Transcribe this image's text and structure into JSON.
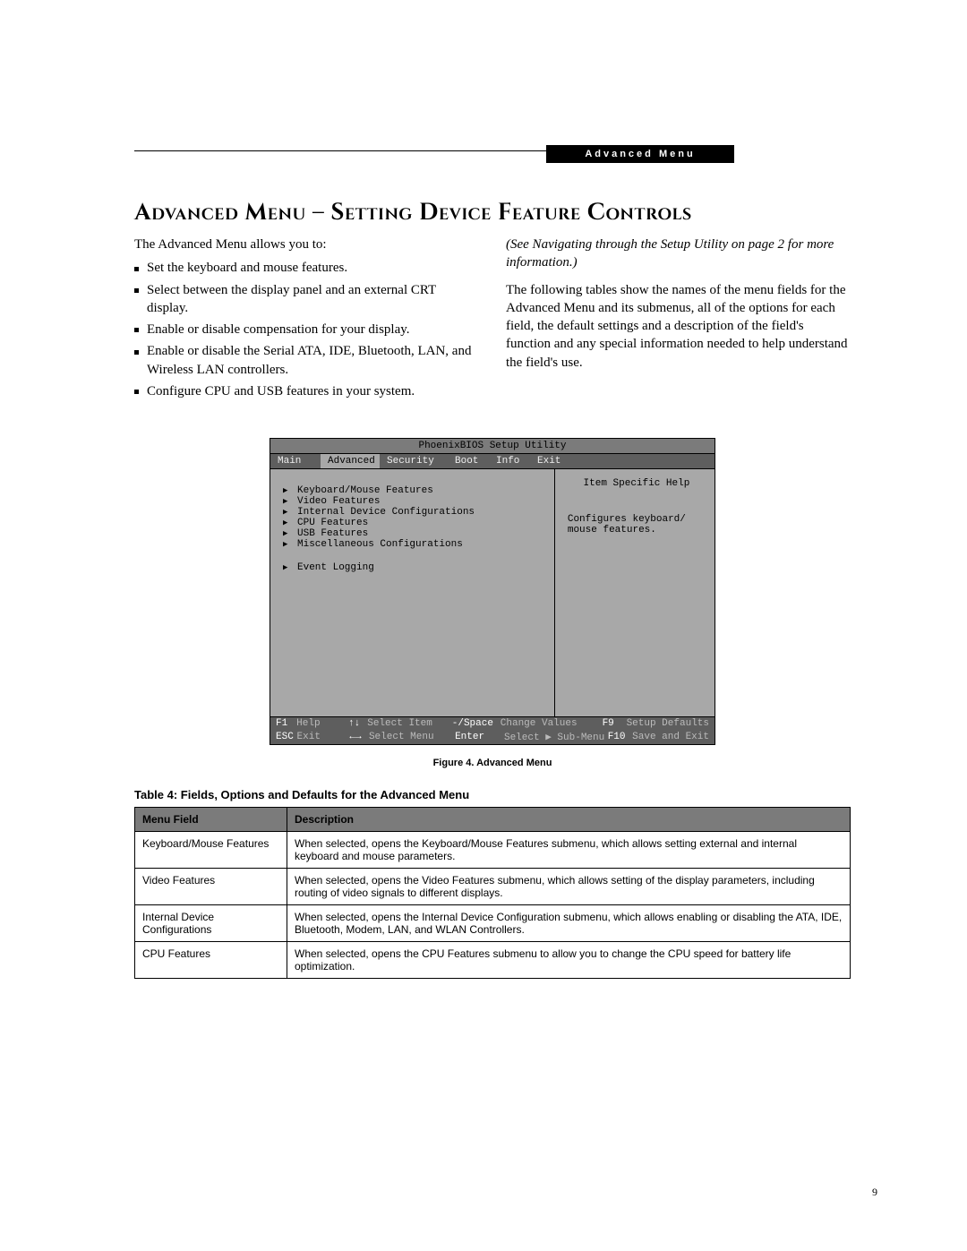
{
  "header_band": "Advanced Menu",
  "heading": "Advanced Menu – Setting Device Feature Controls",
  "intro": "The Advanced Menu allows you to:",
  "bullets": [
    "Set the keyboard and mouse features.",
    "Select between the display panel and an external CRT display.",
    "Enable or disable compensation for your display.",
    "Enable or disable the Serial ATA, IDE, Bluetooth, LAN, and Wireless LAN controllers.",
    "Configure CPU and USB features in your system."
  ],
  "right_paras": {
    "navnote": "(See Navigating through the Setup Utility on page 2 for more information.)",
    "body": "The following tables show the names of the menu fields for the Advanced Menu and its submenus, all of the options for each field, the default settings and a description of the field's function and any special information needed to help understand the field's use."
  },
  "bios": {
    "title": "PhoenixBIOS Setup Utility",
    "tabs": [
      "Main",
      "Advanced",
      "Security",
      "Boot",
      "Info",
      "Exit"
    ],
    "active_tab": "Advanced",
    "menu": [
      "Keyboard/Mouse Features",
      "Video Features",
      "Internal Device Configurations",
      "CPU Features",
      "USB Features",
      "Miscellaneous Configurations",
      "",
      "Event Logging"
    ],
    "help": {
      "title": "Item Specific Help",
      "text": "Configures keyboard/ mouse features."
    },
    "footer": {
      "r1k1": "F1",
      "r1v1": "Help",
      "r1k2": "↑↓",
      "r1v2": "Select Item",
      "r1k3": "-/Space",
      "r1v3": "Change Values",
      "r1k4": "F9",
      "r1v4": "Setup Defaults",
      "r2k1": "ESC",
      "r2v1": "Exit",
      "r2k2": "←→",
      "r2v2": "Select Menu",
      "r2k3": "Enter",
      "r2v3": "Select ▶ Sub-Menu",
      "r2k4": "F10",
      "r2v4": "Save and Exit"
    }
  },
  "figure_caption": "Figure 4.  Advanced Menu",
  "table_caption": "Table 4: Fields, Options and Defaults for the Advanced Menu",
  "table": {
    "headers": [
      "Menu Field",
      "Description"
    ],
    "rows": [
      [
        "Keyboard/Mouse Features",
        "When selected, opens the Keyboard/Mouse Features submenu, which allows setting external and internal keyboard and mouse parameters."
      ],
      [
        "Video Features",
        "When selected, opens the Video Features submenu, which allows setting of the display parameters, including routing of video signals to different displays."
      ],
      [
        "Internal Device Configurations",
        "When selected, opens the Internal Device Configuration submenu, which allows enabling or disabling the ATA, IDE, Bluetooth, Modem, LAN, and WLAN Controllers."
      ],
      [
        "CPU Features",
        "When selected, opens the CPU Features submenu to allow you to change the CPU speed for battery life optimization."
      ]
    ]
  },
  "page_number": "9"
}
